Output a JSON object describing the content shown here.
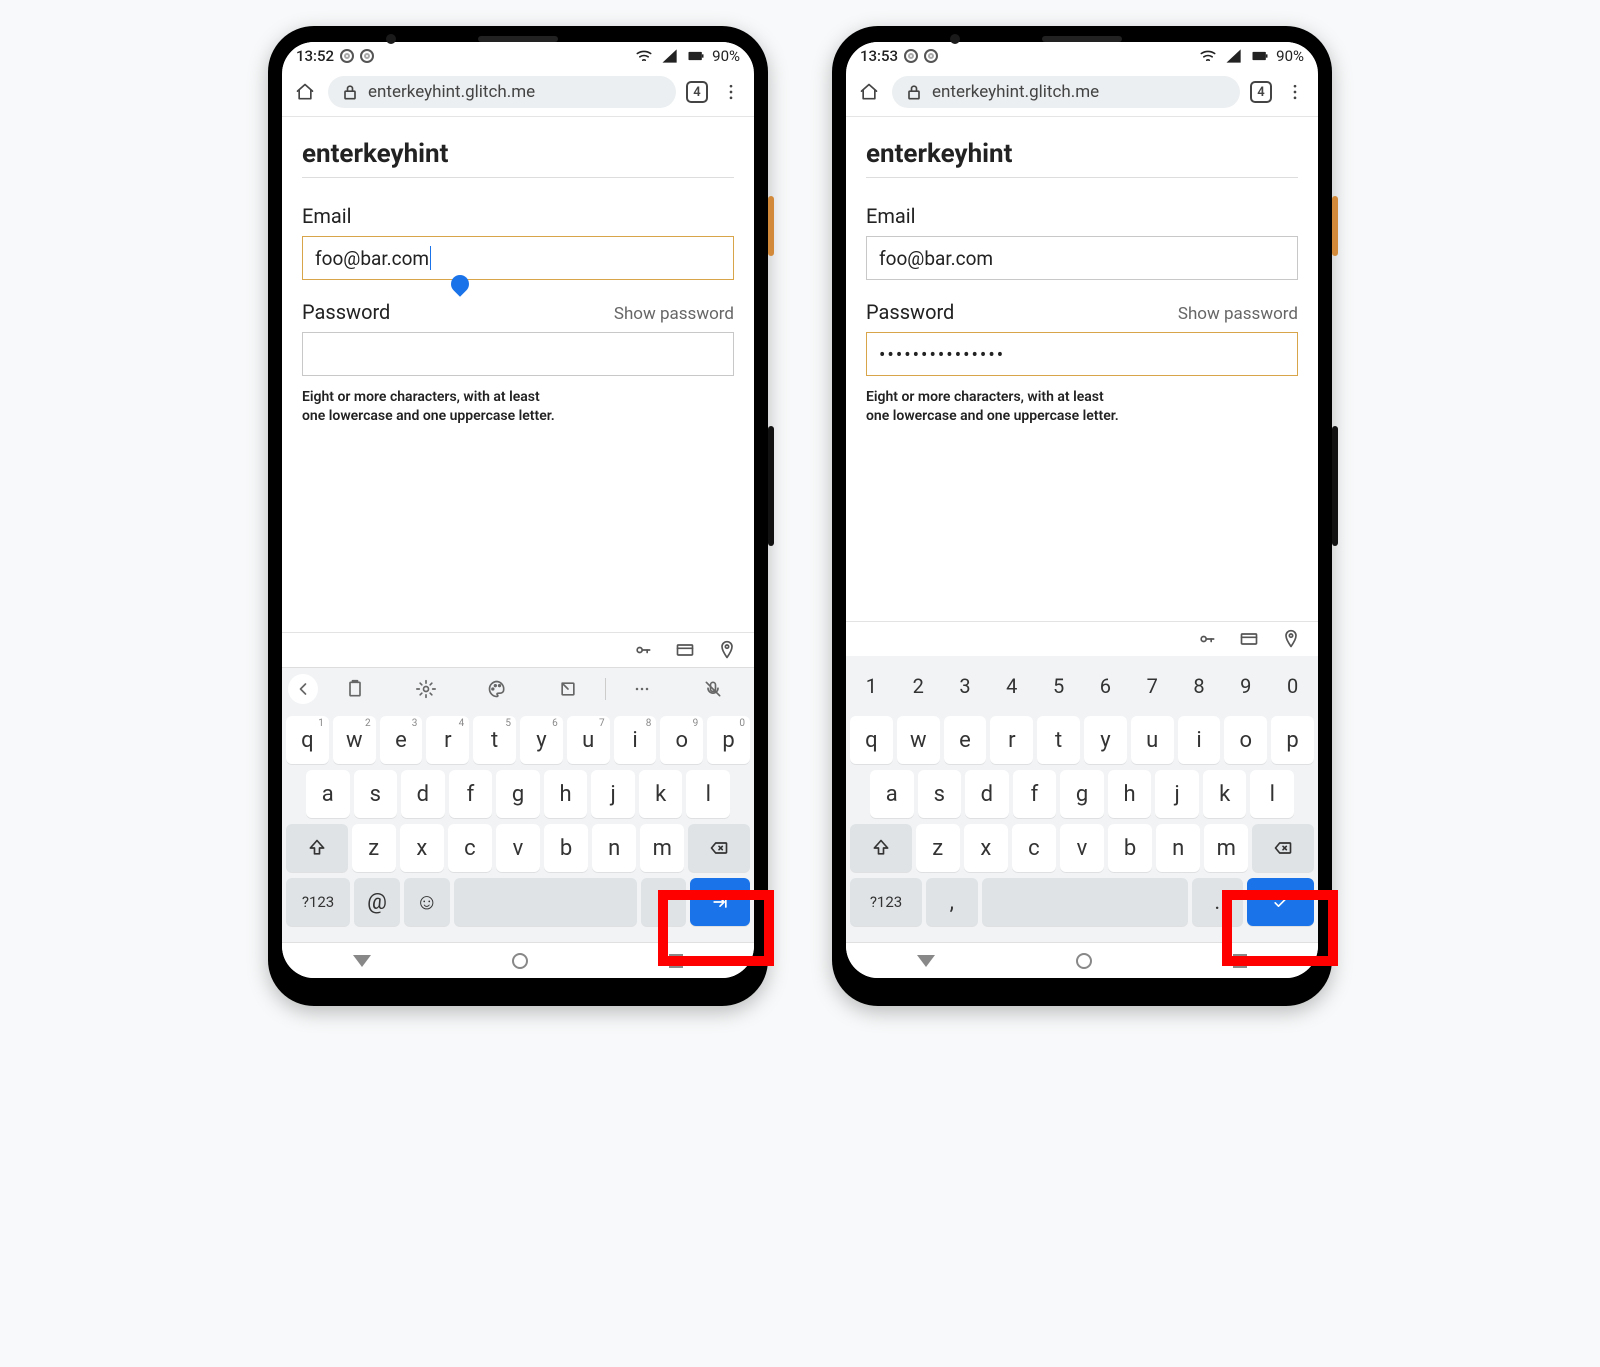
{
  "phones": [
    {
      "status": {
        "time": "13:52",
        "battery": "90%"
      },
      "url": "enterkeyhint.glitch.me",
      "tab_count": "4",
      "page": {
        "title": "enterkeyhint",
        "email_label": "Email",
        "email_value": "foo@bar.com",
        "email_focused": true,
        "password_label": "Password",
        "show_password": "Show password",
        "password_value": "",
        "password_focused": false,
        "help_l1": "Eight or more characters, with at least",
        "help_l2": "one lowercase and one uppercase letter."
      },
      "keyboard": {
        "has_numrow": false,
        "has_toolbar": true,
        "row4_left": "?123",
        "row4_sym1": "@",
        "row4_sym2": "☺",
        "row4_period": ".",
        "enter_icon": "next"
      }
    },
    {
      "status": {
        "time": "13:53",
        "battery": "90%"
      },
      "url": "enterkeyhint.glitch.me",
      "tab_count": "4",
      "page": {
        "title": "enterkeyhint",
        "email_label": "Email",
        "email_value": "foo@bar.com",
        "email_focused": false,
        "password_label": "Password",
        "show_password": "Show password",
        "password_value": "•••••••••••••••",
        "password_focused": true,
        "help_l1": "Eight or more characters, with at least",
        "help_l2": "one lowercase and one uppercase letter."
      },
      "keyboard": {
        "has_numrow": true,
        "has_toolbar": false,
        "row4_left": "?123",
        "row4_sym1": ",",
        "row4_sym2": "",
        "row4_period": ".",
        "enter_icon": "done"
      }
    }
  ],
  "kb": {
    "nums": [
      "1",
      "2",
      "3",
      "4",
      "5",
      "6",
      "7",
      "8",
      "9",
      "0"
    ],
    "row1": [
      "q",
      "w",
      "e",
      "r",
      "t",
      "y",
      "u",
      "i",
      "o",
      "p"
    ],
    "row1_sup": [
      "1",
      "2",
      "3",
      "4",
      "5",
      "6",
      "7",
      "8",
      "9",
      "0"
    ],
    "row2": [
      "a",
      "s",
      "d",
      "f",
      "g",
      "h",
      "j",
      "k",
      "l"
    ],
    "row3": [
      "z",
      "x",
      "c",
      "v",
      "b",
      "n",
      "m"
    ]
  }
}
